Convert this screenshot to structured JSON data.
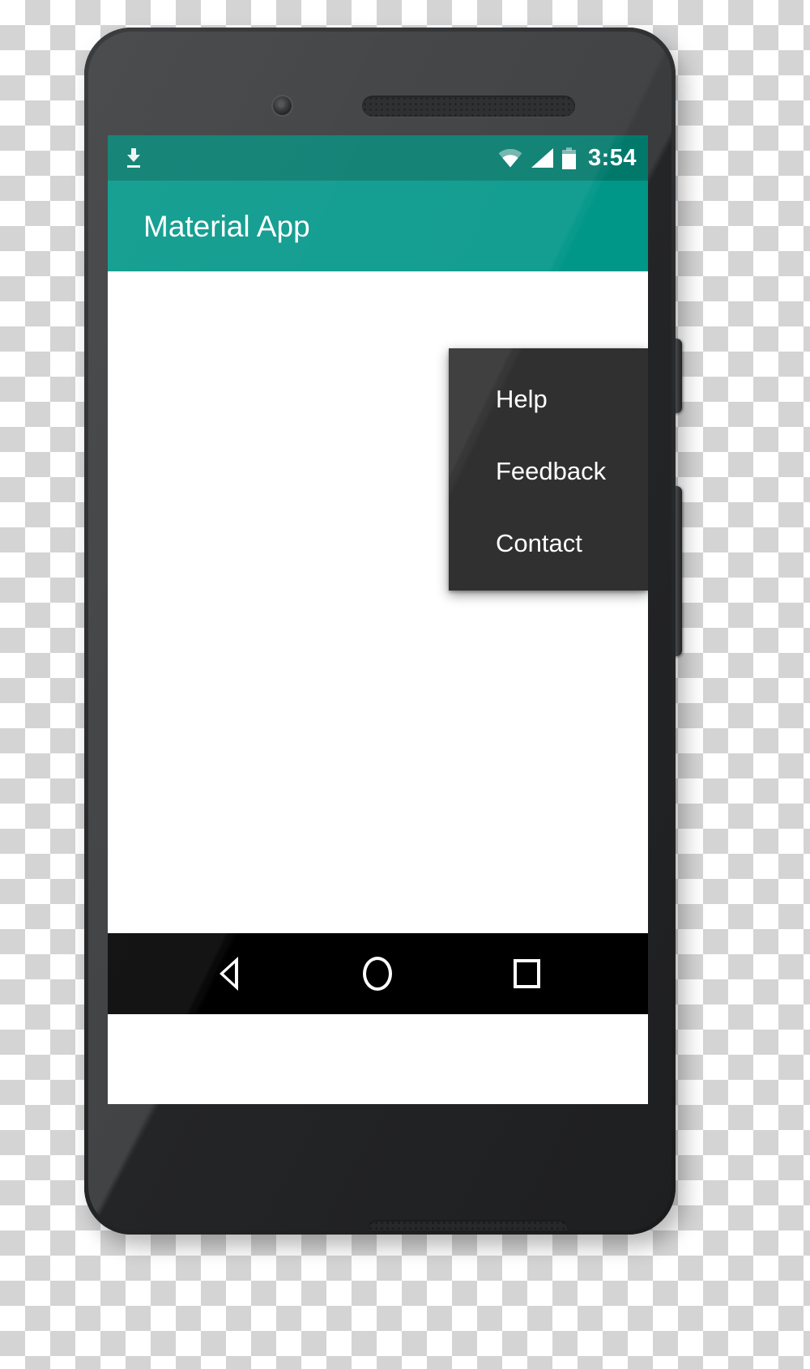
{
  "device": {
    "name": "android-phone-mockup",
    "front_camera": "front-camera",
    "earpiece": "earpiece-speaker-grille",
    "bottom_speaker": "bottom-speaker-grille",
    "power_button": "power-button",
    "volume_button": "volume-rocker"
  },
  "status_bar": {
    "background": "#00796b",
    "notification_icon": "download-icon",
    "icons": [
      "wifi-icon",
      "cellular-signal-icon",
      "battery-icon"
    ],
    "clock": "3:54"
  },
  "app_bar": {
    "background": "#009688",
    "title": "Material App"
  },
  "popup_menu": {
    "background": "#303030",
    "items": [
      {
        "label": "Help"
      },
      {
        "label": "Feedback"
      },
      {
        "label": "Contact"
      }
    ]
  },
  "content": {
    "background": "#ffffff",
    "text": ""
  },
  "nav_bar": {
    "background": "#000000",
    "buttons": [
      {
        "name": "back-button",
        "icon": "triangle-left-icon"
      },
      {
        "name": "home-button",
        "icon": "circle-icon"
      },
      {
        "name": "recents-button",
        "icon": "square-icon"
      }
    ]
  }
}
